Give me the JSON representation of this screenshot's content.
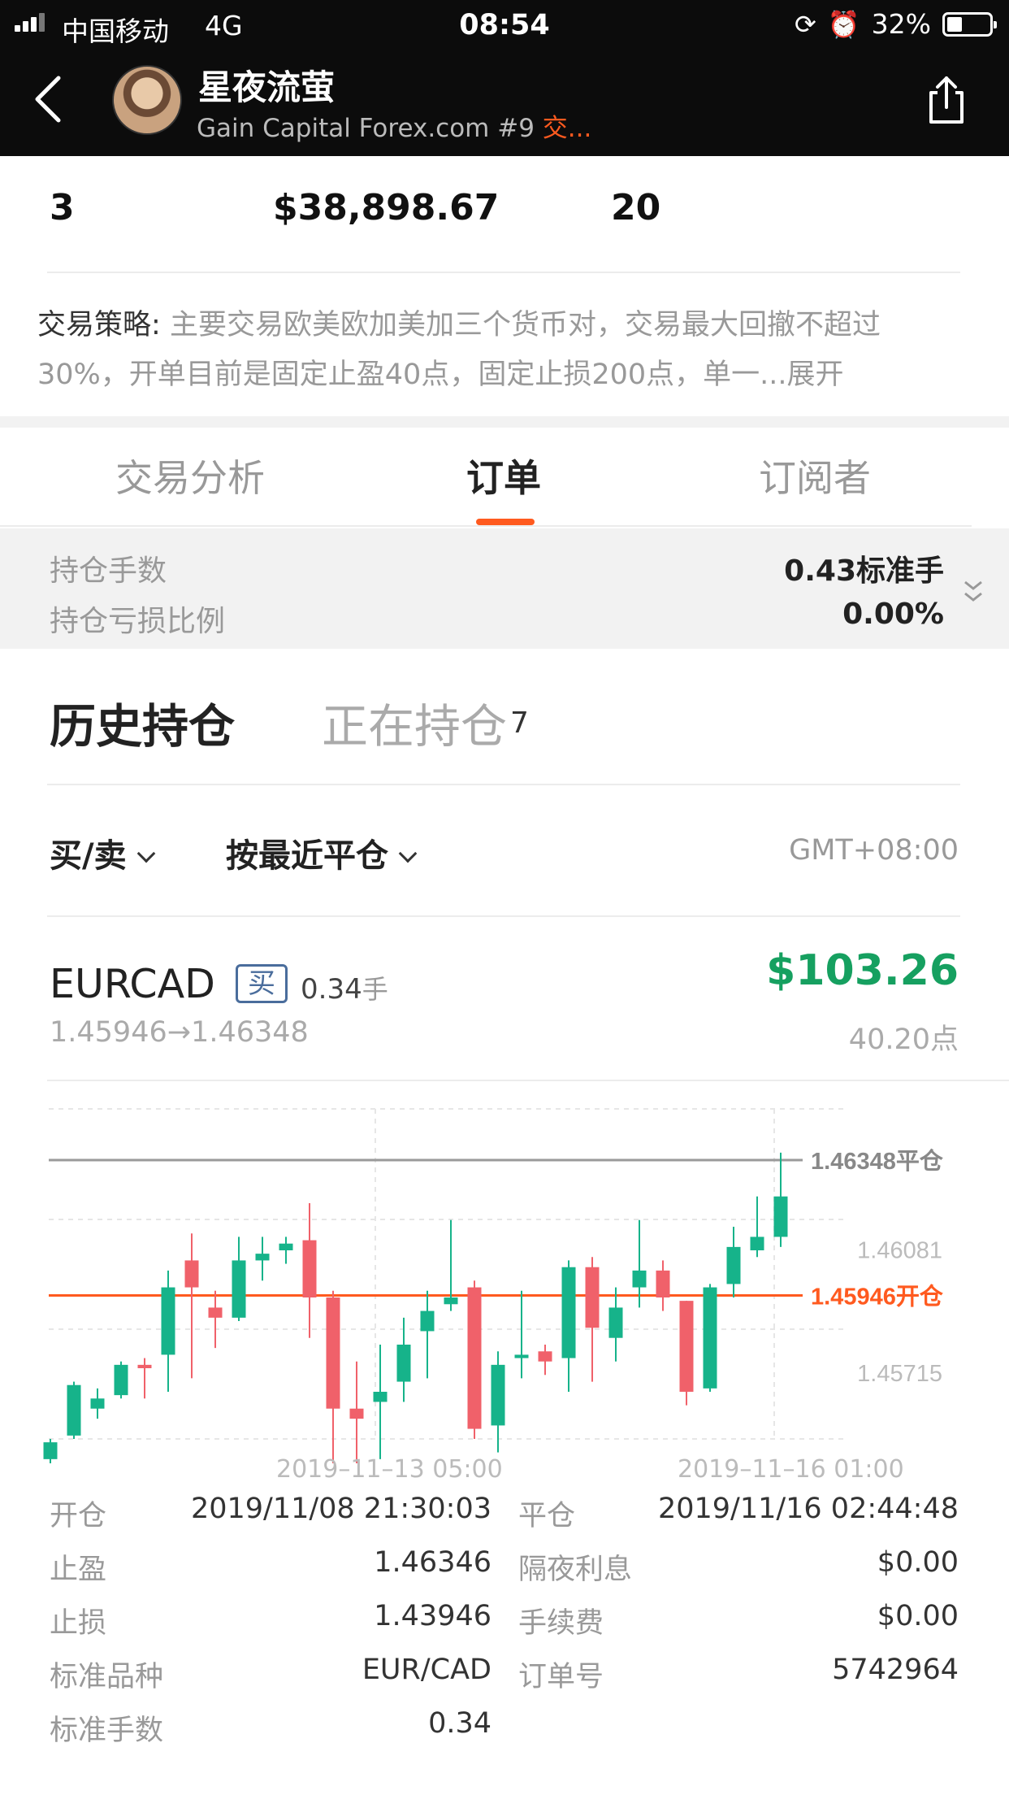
{
  "status_bar": {
    "carrier": "中国移动",
    "network": "4G",
    "time": "08:54",
    "battery_percent": "32%",
    "battery_level": 0.32
  },
  "header": {
    "title": "星夜流萤",
    "subtitle": "Gain Capital Forex.com #9",
    "subtitle_tag": "交..."
  },
  "stats": {
    "values": [
      "3",
      "$38,898.67",
      "20"
    ]
  },
  "strategy": {
    "label": "交易策略:",
    "text": "主要交易欧美欧加美加三个货币对，交易最大回撤不超过30%，开单目前是固定止盈40点，固定止损200点，单一...",
    "more": "展开"
  },
  "tabs": [
    {
      "label": "交易分析",
      "active": false
    },
    {
      "label": "订单",
      "active": true
    },
    {
      "label": "订阅者",
      "active": false
    }
  ],
  "summary": {
    "rows": [
      {
        "label": "持仓手数",
        "value": "0.43标准手"
      },
      {
        "label": "持仓亏损比例",
        "value": "0.00%"
      }
    ]
  },
  "subtabs": {
    "history": "历史持仓",
    "open": "正在持仓",
    "open_count": "7"
  },
  "filters": {
    "side": "买/卖",
    "sort": "按最近平仓",
    "timezone": "GMT+08:00"
  },
  "order": {
    "symbol": "EURCAD",
    "side": "买",
    "lots": "0.34",
    "lots_unit": "手",
    "pnl": "$103.26",
    "price_range": "1.45946→1.46348",
    "points": "40.20点",
    "details_left": [
      {
        "label": "开仓",
        "value": "2019/11/08 21:30:03"
      },
      {
        "label": "止盈",
        "value": "1.46346"
      },
      {
        "label": "止损",
        "value": "1.43946"
      },
      {
        "label": "标准品种",
        "value": "EUR/CAD"
      },
      {
        "label": "标准手数",
        "value": "0.34"
      }
    ],
    "details_right": [
      {
        "label": "平仓",
        "value": "2019/11/16 02:44:48"
      },
      {
        "label": "隔夜利息",
        "value": "$0.00"
      },
      {
        "label": "手续费",
        "value": "$0.00"
      },
      {
        "label": "订单号",
        "value": "5742964"
      }
    ]
  },
  "colors": {
    "accent": "#ff5a1f",
    "up": "#16b38a",
    "down": "#f0616a",
    "profit": "#16a060",
    "close_line": "#9a9a9a",
    "badge": "#4a6d9c"
  },
  "chart_data": {
    "type": "candlestick",
    "y_ticks": [
      "1.46081",
      "1.45715"
    ],
    "ylim": [
      1.4552,
      1.465
    ],
    "x_ticks": [
      "2019–11–13 05:00",
      "2019–11–16 01:00"
    ],
    "reference_lines": [
      {
        "label": "1.46348平仓",
        "value": 1.46348
      },
      {
        "label": "1.45946开仓",
        "value": 1.45946
      }
    ],
    "candles": [
      {
        "o": 1.4546,
        "h": 1.4552,
        "l": 1.4542,
        "c": 1.4551
      },
      {
        "o": 1.4553,
        "h": 1.4569,
        "l": 1.4552,
        "c": 1.4568
      },
      {
        "o": 1.4561,
        "h": 1.4567,
        "l": 1.4558,
        "c": 1.4564
      },
      {
        "o": 1.4565,
        "h": 1.4575,
        "l": 1.4564,
        "c": 1.4574
      },
      {
        "o": 1.4574,
        "h": 1.4576,
        "l": 1.4564,
        "c": 1.4573
      },
      {
        "o": 1.4577,
        "h": 1.4602,
        "l": 1.4566,
        "c": 1.4597
      },
      {
        "o": 1.4605,
        "h": 1.4613,
        "l": 1.457,
        "c": 1.4597
      },
      {
        "o": 1.4591,
        "h": 1.4596,
        "l": 1.4579,
        "c": 1.4588
      },
      {
        "o": 1.4588,
        "h": 1.4612,
        "l": 1.4587,
        "c": 1.4605
      },
      {
        "o": 1.4605,
        "h": 1.4612,
        "l": 1.4599,
        "c": 1.4607
      },
      {
        "o": 1.4608,
        "h": 1.4612,
        "l": 1.4604,
        "c": 1.461
      },
      {
        "o": 1.4611,
        "h": 1.4622,
        "l": 1.4582,
        "c": 1.4594
      },
      {
        "o": 1.4594,
        "h": 1.4596,
        "l": 1.4536,
        "c": 1.4561
      },
      {
        "o": 1.4561,
        "h": 1.4575,
        "l": 1.4534,
        "c": 1.4558
      },
      {
        "o": 1.4563,
        "h": 1.458,
        "l": 1.4546,
        "c": 1.4566
      },
      {
        "o": 1.4569,
        "h": 1.4588,
        "l": 1.4563,
        "c": 1.458
      },
      {
        "o": 1.4584,
        "h": 1.4596,
        "l": 1.457,
        "c": 1.459
      },
      {
        "o": 1.4592,
        "h": 1.4617,
        "l": 1.459,
        "c": 1.4594
      },
      {
        "o": 1.4597,
        "h": 1.4599,
        "l": 1.4552,
        "c": 1.4555
      },
      {
        "o": 1.4556,
        "h": 1.4578,
        "l": 1.4548,
        "c": 1.4574
      },
      {
        "o": 1.4576,
        "h": 1.4596,
        "l": 1.457,
        "c": 1.4577
      },
      {
        "o": 1.4578,
        "h": 1.458,
        "l": 1.4571,
        "c": 1.4575
      },
      {
        "o": 1.4576,
        "h": 1.4605,
        "l": 1.4566,
        "c": 1.4603
      },
      {
        "o": 1.4603,
        "h": 1.4606,
        "l": 1.4569,
        "c": 1.4585
      },
      {
        "o": 1.4582,
        "h": 1.4597,
        "l": 1.4575,
        "c": 1.4591
      },
      {
        "o": 1.4597,
        "h": 1.4617,
        "l": 1.4591,
        "c": 1.4602
      },
      {
        "o": 1.4602,
        "h": 1.4605,
        "l": 1.459,
        "c": 1.4594
      },
      {
        "o": 1.4593,
        "h": 1.4593,
        "l": 1.4562,
        "c": 1.4566
      },
      {
        "o": 1.4567,
        "h": 1.4598,
        "l": 1.4566,
        "c": 1.4597
      },
      {
        "o": 1.4598,
        "h": 1.4615,
        "l": 1.4594,
        "c": 1.4609
      },
      {
        "o": 1.4608,
        "h": 1.4624,
        "l": 1.4606,
        "c": 1.4612
      },
      {
        "o": 1.4612,
        "h": 1.4637,
        "l": 1.4609,
        "c": 1.4624
      }
    ]
  }
}
